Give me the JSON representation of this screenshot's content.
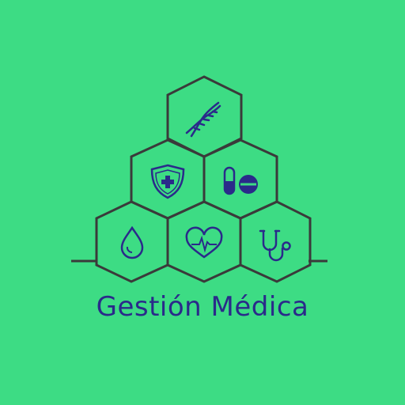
{
  "brand": {
    "name": "Gestión Médica"
  },
  "colors": {
    "background": "#3ddc84",
    "line": "#3a3a3a",
    "icon": "#2a2a8a"
  },
  "icons": [
    "dna-icon",
    "shield-cross-icon",
    "pills-icon",
    "drop-icon",
    "heart-pulse-icon",
    "stethoscope-icon"
  ]
}
